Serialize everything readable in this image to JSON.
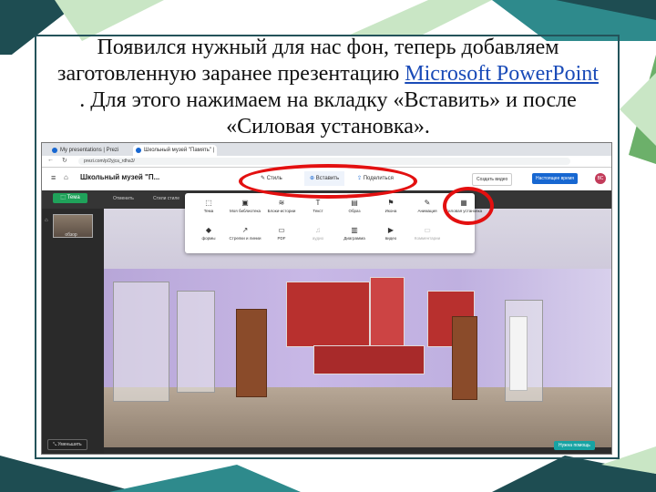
{
  "slide": {
    "text_before": "Появился нужный для нас фон, теперь добавляем заготовленную заранее презентацию ",
    "link_text": "Microsoft PowerPoint ",
    "text_after": ". Для этого нажимаем на вкладку «Вставить» и после «Силовая установка»."
  },
  "browser": {
    "tabs": [
      "My presentations | Prezi",
      "Школьный музей \"Память\" | Pr..."
    ],
    "url": "prezi.com/p/2yjca_rdha3/"
  },
  "app": {
    "title": "Школьный музей \"П...",
    "top_tabs": {
      "style": "Стиль",
      "insert": "Вставить",
      "share": "Поделиться"
    },
    "create_video": "Создать видео",
    "present": "Настоящее время",
    "avatar": "ВС"
  },
  "toolbar": {
    "theme": "Тема",
    "undo": "Отменить",
    "redo": "Стили стиле"
  },
  "thumbnail_label": "обзор",
  "insert_menu": {
    "row1": [
      {
        "icon": "⬚",
        "label": "Тема"
      },
      {
        "icon": "▣",
        "label": "Моя библиотека"
      },
      {
        "icon": "≋",
        "label": "Блоки-истории"
      },
      {
        "icon": "T",
        "label": "Текст"
      },
      {
        "icon": "▤",
        "label": "Образ"
      },
      {
        "icon": "⚑",
        "label": "Икона"
      },
      {
        "icon": "✎",
        "label": "Анимация"
      },
      {
        "icon": "▦",
        "label": "Силовая установка"
      }
    ],
    "row2": [
      {
        "icon": "◆",
        "label": "формы"
      },
      {
        "icon": "↗",
        "label": "Стрелки и линии"
      },
      {
        "icon": "▭",
        "label": "PDF"
      },
      {
        "icon": "♫",
        "label": "аудио"
      },
      {
        "icon": "▥",
        "label": "Диаграмма"
      },
      {
        "icon": "▶",
        "label": "видео"
      },
      {
        "icon": "▭",
        "label": "Комментарии"
      }
    ]
  },
  "bottom": {
    "zoom_out": "Уменьшить",
    "help": "Нужна помощь"
  },
  "colors": {
    "accent_red": "#e31010",
    "prezi_blue": "#1767d1",
    "theme_green": "#1fa25a",
    "frame": "#23535a"
  }
}
